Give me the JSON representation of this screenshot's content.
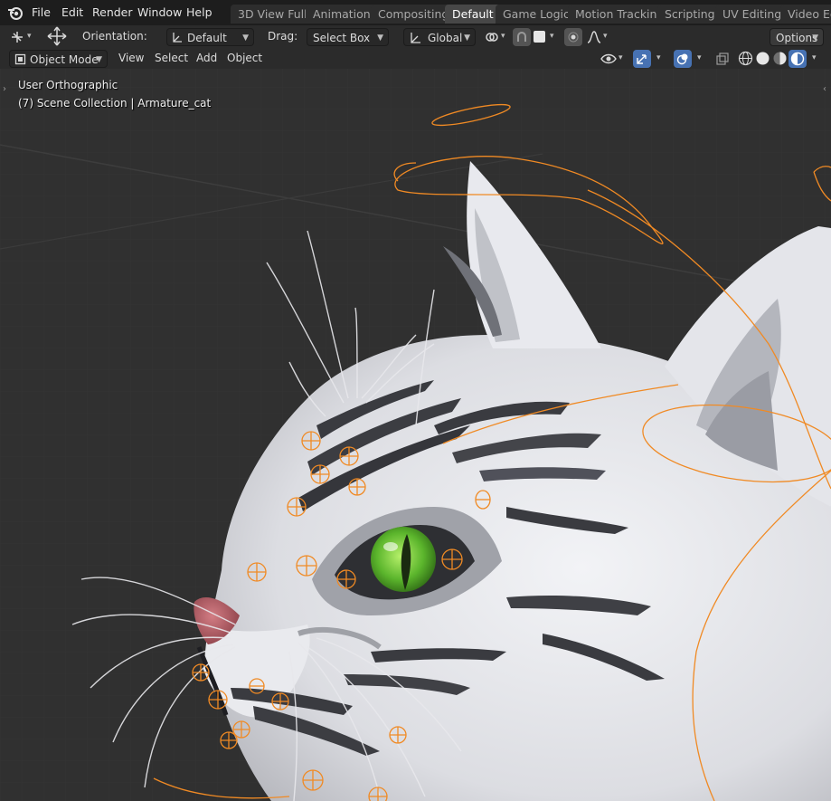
{
  "menubar": {
    "items": [
      "File",
      "Edit",
      "Render",
      "Window",
      "Help"
    ]
  },
  "workspaces": {
    "tabs": [
      "3D View Full",
      "Animation",
      "Compositing",
      "Default",
      "Game Logic",
      "Motion Tracking",
      "Scripting",
      "UV Editing",
      "Video Edit"
    ],
    "active": "Default"
  },
  "toolbar": {
    "orientation_label": "Orientation:",
    "orientation_value": "Default",
    "drag_label": "Drag:",
    "drag_value": "Select Box",
    "transform_orientation": "Global",
    "options_label": "Options"
  },
  "viewport_header": {
    "mode": "Object Mode",
    "menus": [
      "View",
      "Select",
      "Add",
      "Object"
    ]
  },
  "viewport": {
    "view_name": "User Orthographic",
    "collection_info": "(7) Scene Collection | Armature_cat"
  },
  "colors": {
    "accent": "#4772b3",
    "bone_orange": "#f08a24",
    "background": "#303030"
  },
  "icons": [
    "blender-logo-icon",
    "transform-pivot-icon",
    "move-gizmo-icon",
    "orientation-axes-icon",
    "global-axes-icon",
    "link-icon",
    "snap-icon",
    "proportional-edit-icon",
    "falloff-curve-icon",
    "object-mode-icon",
    "visibility-eye-icon",
    "gizmo-icon",
    "overlay-icon",
    "xray-icon",
    "shading-wireframe-icon",
    "shading-solid-icon",
    "shading-material-icon",
    "shading-rendered-icon"
  ]
}
